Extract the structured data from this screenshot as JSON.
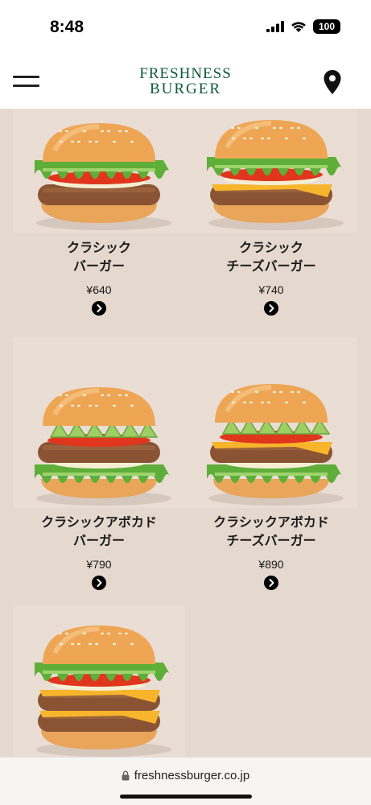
{
  "status": {
    "time": "8:48",
    "battery": "100"
  },
  "header": {
    "logo_line1": "FRESHNESS",
    "logo_line2": "BURGER"
  },
  "products": [
    {
      "name": "クラシック\nバーガー",
      "price": "¥640",
      "image": "classic-burger",
      "cheese": false,
      "avocado": false,
      "double": false
    },
    {
      "name": "クラシック\nチーズバーガー",
      "price": "¥740",
      "image": "classic-cheeseburger",
      "cheese": true,
      "avocado": false,
      "double": false
    },
    {
      "name": "クラシックアボカド\nバーガー",
      "price": "¥790",
      "image": "classic-avocado-burger",
      "cheese": false,
      "avocado": true,
      "double": false
    },
    {
      "name": "クラシックアボカド\nチーズバーガー",
      "price": "¥890",
      "image": "classic-avocado-cheeseburger",
      "cheese": true,
      "avocado": true,
      "double": false
    },
    {
      "name": "",
      "price": "",
      "image": "double-classic-cheeseburger",
      "cheese": true,
      "avocado": false,
      "double": true
    }
  ],
  "browser": {
    "url": "freshnessburger.co.jp"
  },
  "colors": {
    "brand_green": "#0f5a3a",
    "background": "#e5d8ce"
  },
  "icons": [
    "menu-icon",
    "location-pin-icon",
    "chevron-right-icon",
    "lock-icon",
    "signal-icon",
    "wifi-icon"
  ]
}
